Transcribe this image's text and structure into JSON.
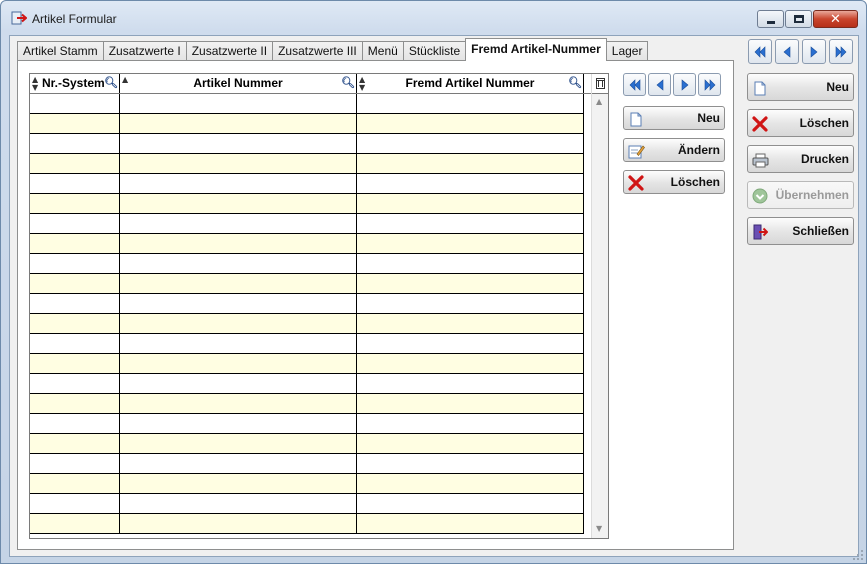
{
  "window": {
    "title": "Artikel Formular"
  },
  "tabs": [
    {
      "label": "Artikel Stamm",
      "active": false
    },
    {
      "label": "Zusatzwerte I",
      "active": false
    },
    {
      "label": "Zusatzwerte II",
      "active": false
    },
    {
      "label": "Zusatzwerte III",
      "active": false
    },
    {
      "label": "Menü",
      "active": false
    },
    {
      "label": "Stückliste",
      "active": false
    },
    {
      "label": "Fremd Artikel-Nummer",
      "active": true
    },
    {
      "label": "Lager",
      "active": false
    }
  ],
  "grid": {
    "columns": [
      "Nr.-System",
      "Artikel Nummer",
      "Fremd Artikel Nummer"
    ],
    "row_colors": {
      "normal": "#ffffff",
      "alternate": "#fffee2"
    }
  },
  "inner_buttons": {
    "new": "Neu",
    "edit": "Ändern",
    "delete": "Löschen"
  },
  "side_buttons": {
    "new": "Neu",
    "delete": "Löschen",
    "print": "Drucken",
    "apply": "Übernehmen",
    "close": "Schließen"
  },
  "colors": {
    "nav_arrow": "#2a6fd0",
    "delete_red": "#d01515"
  }
}
